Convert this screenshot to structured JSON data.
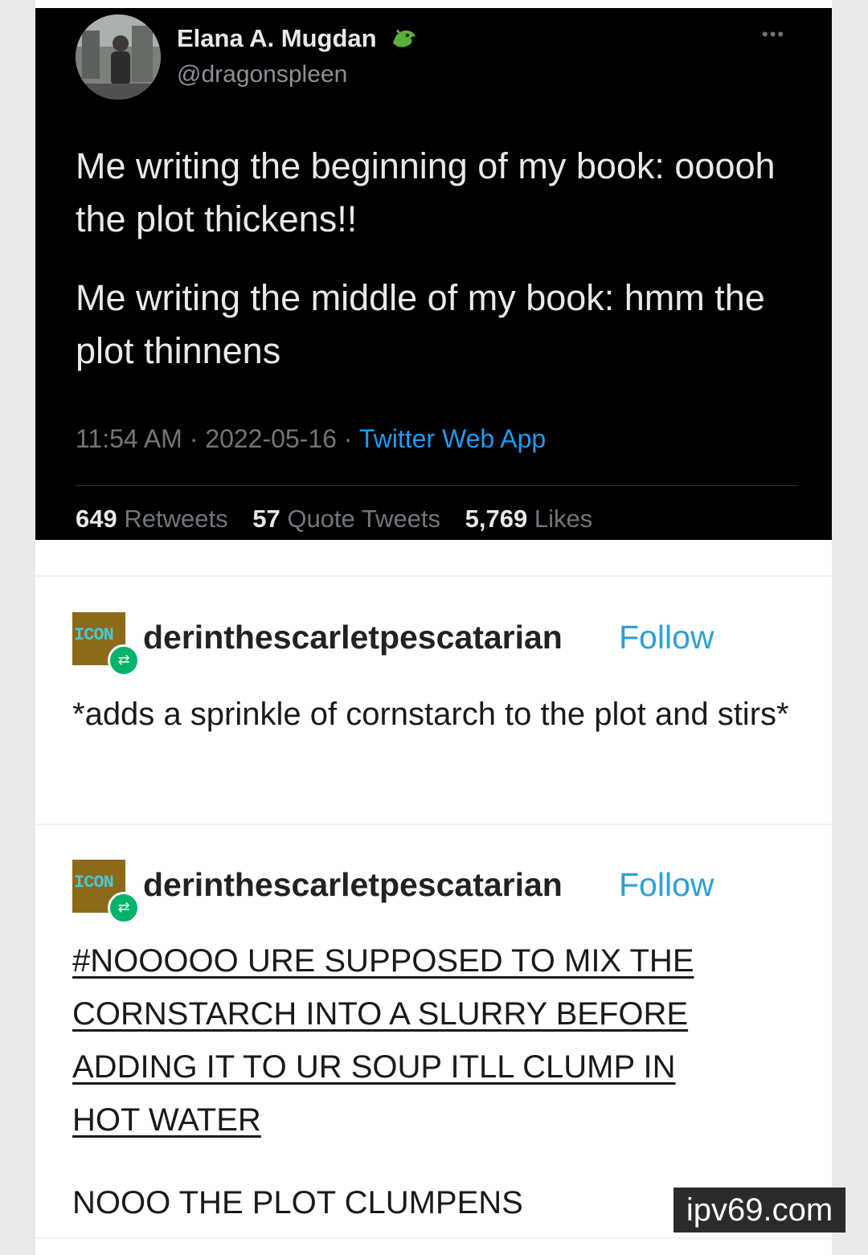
{
  "tweet": {
    "display_name": "Elana A. Mugdan",
    "handle": "@dragonspleen",
    "paragraphs": [
      "Me writing the beginning of my book: ooooh the plot thickens!!",
      "Me writing the middle of my book: hmm the plot thinnens"
    ],
    "time": "11:54 AM",
    "date": "2022-05-16",
    "source": "Twitter Web App",
    "retweets_count": "649",
    "retweets_label": "Retweets",
    "quotes_count": "57",
    "quotes_label": "Quote Tweets",
    "likes_count": "5,769",
    "likes_label": "Likes",
    "accent_color": "#1d9bf0"
  },
  "posts": [
    {
      "icon_text": "ICON",
      "username": "derinthescarletpescatarian",
      "follow_label": "Follow",
      "body": "*adds a sprinkle of cornstarch to the plot and stirs*"
    },
    {
      "icon_text": "ICON",
      "username": "derinthescarletpescatarian",
      "follow_label": "Follow",
      "tag_lines": [
        "#NOOOOO URE SUPPOSED TO MIX THE",
        "CORNSTARCH INTO A SLURRY BEFORE",
        "ADDING IT TO UR SOUP ITLL CLUMP IN",
        "HOT WATER"
      ],
      "body": "NOOO THE PLOT CLUMPENS"
    }
  ],
  "watermark": "ipv69.com",
  "colors": {
    "follow": "#2e9fd6",
    "tweet_bg": "#000000",
    "reblog": "#00b26a"
  }
}
